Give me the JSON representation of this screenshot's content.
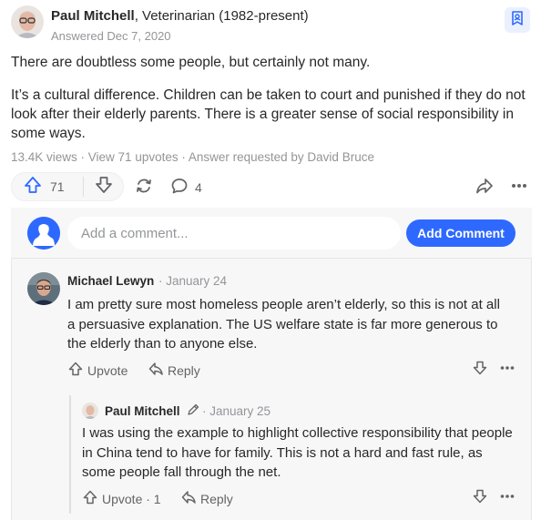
{
  "answer": {
    "author_name": "Paul Mitchell",
    "author_credential": ", Veterinarian (1982-present)",
    "answered_date": "Answered Dec 7, 2020",
    "paragraphs": [
      "There are doubtless some people, but certainly not many.",
      "It’s a cultural difference. Children can be taken to court and punished if they do not look after their elderly parents. There is a greater sense of social responsibility in some ways."
    ],
    "meta": "13.4K views · View 71 upvotes · Answer requested by David Bruce",
    "upvote_count": "71",
    "comment_count": "4"
  },
  "composer": {
    "placeholder": "Add a comment...",
    "button_label": "Add Comment"
  },
  "comments": [
    {
      "author": "Michael Lewyn",
      "date": "· January 24",
      "text": "I am pretty sure most homeless people aren’t elderly, so this is not at all a persuasive explanation. The US welfare state is far more generous to the elderly than to anyone else.",
      "upvote_label": "Upvote",
      "reply_label": "Reply"
    },
    {
      "author": "Paul Mitchell",
      "date": "· January 25",
      "text": "I was using the example to highlight collective responsibility that people in China tend to have for family. This is not a hard and fast rule, as some people fall through the net.",
      "upvote_label": "Upvote · 1",
      "reply_label": "Reply"
    }
  ],
  "icons": {
    "bookmark": "bookmark-user-icon",
    "upvote": "arrow-up-icon",
    "downvote": "arrow-down-icon",
    "share": "share-cycle-icon",
    "comment": "comment-bubble-icon",
    "forward": "forward-arrow-icon",
    "more": "more-dots-icon",
    "author_pencil": "pencil-icon"
  },
  "colors": {
    "accent": "#2e69ff",
    "text": "#282829",
    "muted": "#939598",
    "panel": "#f7f7f8"
  }
}
